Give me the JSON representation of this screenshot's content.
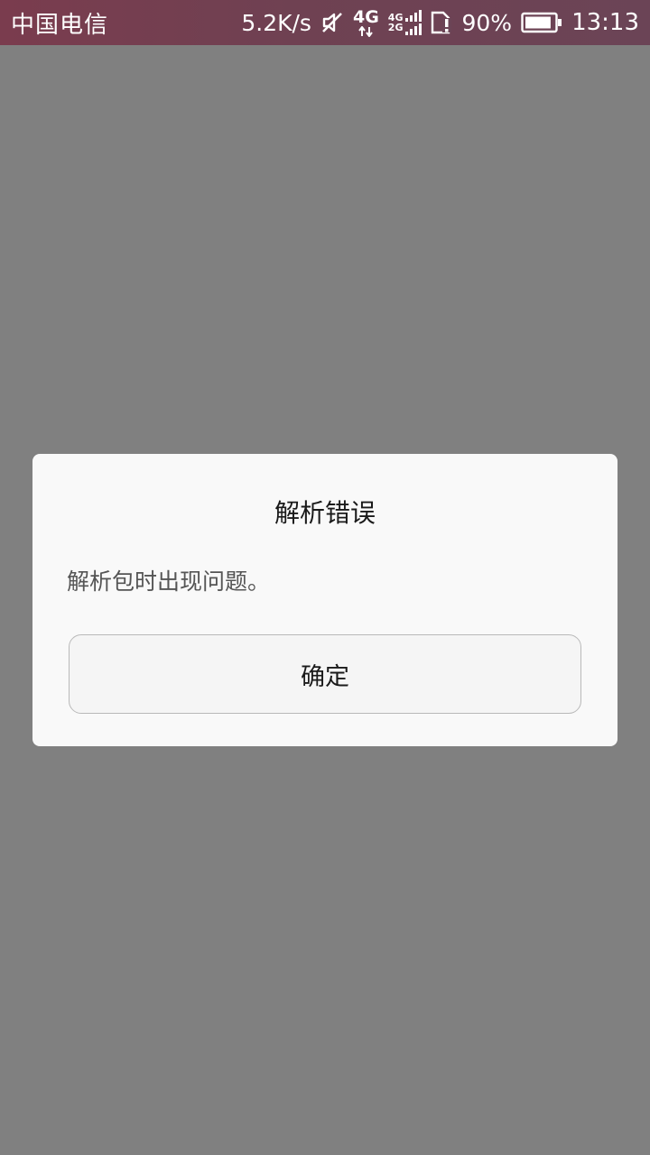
{
  "status_bar": {
    "carrier": "中国电信",
    "net_speed": "5.2K/s",
    "icons": [
      "mute-icon",
      "4g-data-icon",
      "dual-signal-icon",
      "sim-alert-icon",
      "battery-icon"
    ],
    "net_4g": "4G",
    "sig_4g": "4G",
    "sig_2g": "2G",
    "battery_percent": "90%",
    "battery_level": 0.9,
    "time": "13:13"
  },
  "colors": {
    "backdrop": "#808080",
    "status_bar": "#7a3c4e",
    "dialog_bg": "#f9f9f9",
    "button_border": "#b9b9b9"
  },
  "dialog": {
    "title": "解析错误",
    "message": "解析包时出现问题。",
    "ok_label": "确定"
  }
}
